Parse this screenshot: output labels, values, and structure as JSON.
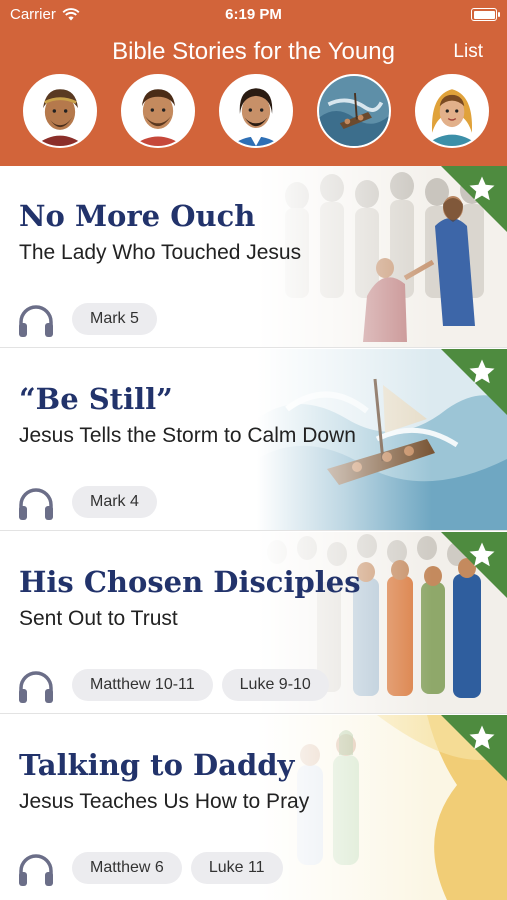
{
  "status": {
    "carrier": "Carrier",
    "time": "6:19 PM"
  },
  "header": {
    "title": "Bible Stories for the Young",
    "list_label": "List",
    "avatars": [
      {
        "name": "character-1"
      },
      {
        "name": "character-2"
      },
      {
        "name": "character-3"
      },
      {
        "name": "character-4"
      },
      {
        "name": "character-5"
      }
    ]
  },
  "colors": {
    "header_bg": "#D2643A",
    "title_navy": "#22336B",
    "favorite_green": "#4E8B3F",
    "chip_bg": "#ECECEF"
  },
  "stories": [
    {
      "title": "No More Ouch",
      "subtitle": "The Lady Who Touched Jesus",
      "refs": [
        "Mark 5"
      ],
      "icon": "headphones-icon"
    },
    {
      "title": "“Be Still”",
      "subtitle": "Jesus Tells the Storm to Calm Down",
      "refs": [
        "Mark 4"
      ],
      "icon": "headphones-icon"
    },
    {
      "title": "His Chosen Disciples",
      "subtitle": "Sent Out to Trust",
      "refs": [
        "Matthew 10-11",
        "Luke 9-10"
      ],
      "icon": "headphones-icon"
    },
    {
      "title": "Talking to Daddy",
      "subtitle": "Jesus Teaches Us How to Pray",
      "refs": [
        "Matthew 6",
        "Luke 11"
      ],
      "icon": "headphones-icon"
    }
  ]
}
